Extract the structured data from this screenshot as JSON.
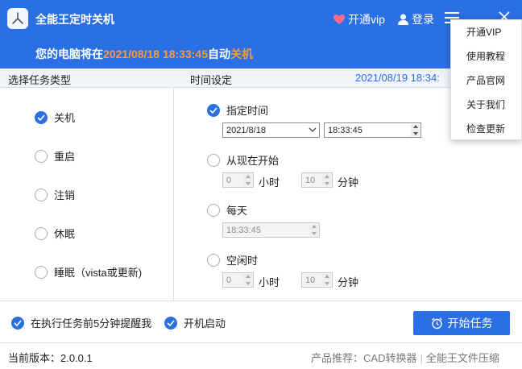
{
  "app": {
    "title": "全能王定时关机",
    "vip_label": "开通vip",
    "login_label": "登录",
    "status_prefix": "您的电脑将在",
    "status_time": "2021/08/18 18:33:45",
    "status_mid": "自动",
    "status_action": "关机"
  },
  "header": {
    "task_type_label": "选择任务类型",
    "time_setting_label": "时间设定",
    "current_datetime": "2021/08/19 18:34:"
  },
  "task_types": [
    {
      "label": "关机",
      "checked": true
    },
    {
      "label": "重启",
      "checked": false
    },
    {
      "label": "注销",
      "checked": false
    },
    {
      "label": "休眠",
      "checked": false
    },
    {
      "label": "睡眠（vista或更新)",
      "checked": false
    }
  ],
  "time_modes": {
    "specified": {
      "label": "指定时间",
      "checked": true,
      "date": "2021/8/18",
      "time": "18:33:45"
    },
    "from_now": {
      "label": "从现在开始",
      "checked": false,
      "hours": "0",
      "hours_unit": "小时",
      "minutes": "10",
      "minutes_unit": "分钟"
    },
    "daily": {
      "label": "每天",
      "checked": false,
      "time": "18:33:45"
    },
    "idle": {
      "label": "空闲时",
      "checked": false,
      "hours": "0",
      "hours_unit": "小时",
      "minutes": "10",
      "minutes_unit": "分钟"
    }
  },
  "options": {
    "remind_label": "在执行任务前5分钟提醒我",
    "autostart_label": "开机启动"
  },
  "start_button": {
    "label": "开始任务"
  },
  "footer": {
    "version": "当前版本：2.0.0.1",
    "recommend_prefix": "产品推荐：",
    "product1": "CAD转换器",
    "product2": "全能王文件压缩"
  },
  "menu": {
    "items": [
      "开通VIP",
      "使用教程",
      "产品官网",
      "关于我们",
      "检查更新"
    ]
  },
  "colors": {
    "brand_blue": "#2b6fe4",
    "highlight_orange": "#ff9a2e"
  }
}
